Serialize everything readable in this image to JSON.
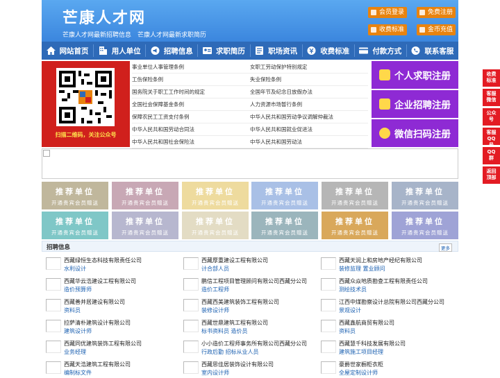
{
  "header": {
    "site_name": "芒康人才网",
    "slogan": "芒康人才网最新招聘信息　芒康人才网最新求职简历",
    "buttons": {
      "member_login": "会员登录",
      "free_register": "免费注册",
      "fee_standard": "收费标准",
      "coin_recharge": "金币充值"
    },
    "colors": {
      "button": "#e8830f",
      "bg": "#3b86de"
    }
  },
  "nav": [
    {
      "label": "网站首页",
      "icon": "home-icon"
    },
    {
      "label": "用人单位",
      "icon": "building-icon"
    },
    {
      "label": "招聘信息",
      "icon": "megaphone-icon"
    },
    {
      "label": "求职简历",
      "icon": "id-card-icon"
    },
    {
      "label": "职场资讯",
      "icon": "news-icon"
    },
    {
      "label": "收费标准",
      "icon": "coin-icon"
    },
    {
      "label": "付款方式",
      "icon": "card-icon"
    },
    {
      "label": "联系客服",
      "icon": "phone-icon"
    }
  ],
  "promo": {
    "qr_caption": "扫描二维码，关注公众号",
    "links": [
      [
        "事业单位人事管理条例",
        "女职工劳动保护特别规定"
      ],
      [
        "工伤保险条例",
        "失业保险条例"
      ],
      [
        "国务院关于职工工作时间的规定",
        "全国年节及纪念日放假办法"
      ],
      [
        "全国社会保障基金条例",
        "人力资源市场暂行条例"
      ],
      [
        "保障农民工工资支付条例",
        "中华人民共和国劳动争议调解仲裁法"
      ],
      [
        "中华人民共和国劳动合同法",
        "中华人民共和国就业促进法"
      ],
      [
        "中华人民共和国社会保险法",
        "中华人民共和国劳动法"
      ]
    ],
    "register": [
      {
        "label": "个人求职注册",
        "icon": "person-icon"
      },
      {
        "label": "企业招聘注册",
        "icon": "company-icon"
      },
      {
        "label": "微信扫码注册",
        "icon": "wechat-icon"
      }
    ],
    "register_colors": [
      "#8e2ad4",
      "#8e2ad4",
      "#8e2ad4"
    ]
  },
  "recommend": {
    "title": "推荐单位",
    "subtitle": "开通贵宾会员赠送",
    "colors": [
      [
        "#c0b79c",
        "#c8a8b5",
        "#eedb9e",
        "#a9c0e6",
        "#b6b6b6",
        "#a7b4c9"
      ],
      [
        "#7fc7c7",
        "#b7b7cf",
        "#e3dcc4",
        "#9bb5bc",
        "#d9a85b",
        "#9fa3d6"
      ]
    ]
  },
  "jobs": {
    "title": "招聘信息",
    "more": "更多",
    "items": [
      {
        "company": "西藏绿恒生态科技有限责任公司",
        "positions": "水利设计"
      },
      {
        "company": "西藏厚重建设工程有限公司",
        "positions": "计合部人员"
      },
      {
        "company": "西藏天润上和房地产经纪有限公司",
        "positions": "装修监理 置业顾问"
      },
      {
        "company": "西藏华云浩建设工程有限公司",
        "positions": "造价预算师"
      },
      {
        "company": "鹏信工程项目管理顾问有限公司西藏分公司",
        "positions": "造价工程师"
      },
      {
        "company": "西藏众焱地质勘查工程有限责任公司",
        "positions": "测绘技术员"
      },
      {
        "company": "西藏善并居建设有限公司",
        "positions": "资料员"
      },
      {
        "company": "西藏西美建筑装饰工程有限公司",
        "positions": "装修设计师"
      },
      {
        "company": "江西中煤勘察设计总院有限公司西藏分公司",
        "positions": "景观设计"
      },
      {
        "company": "拉萨清朴建筑设计有限公司",
        "positions": "建筑设计师"
      },
      {
        "company": "西藏世鼎建筑工程有限公司",
        "positions": "标书资料员 造价员"
      },
      {
        "company": "西藏鑫航商贸有限公司",
        "positions": "资料员"
      },
      {
        "company": "西藏同优建筑装饰工程有限公司",
        "positions": "业务经理"
      },
      {
        "company": "小小造价工程师事务所有限公司西藏分公司",
        "positions": "行政后勤 招标从业人员"
      },
      {
        "company": "西藏慧千科技发展有限公司",
        "positions": "建筑施工项目经理"
      },
      {
        "company": "西藏天浩建筑工程有限公司",
        "positions": "编制标文件"
      },
      {
        "company": "西藏思佳居装饰设计有限公司",
        "positions": "室内设计师"
      },
      {
        "company": "豪爵世家橱柜衣柜",
        "positions": "全屋定制设计师"
      }
    ]
  },
  "side": [
    "收费标准",
    "客服微信",
    "公众号",
    "客服QQ号",
    "QQ群",
    "返回顶部"
  ]
}
